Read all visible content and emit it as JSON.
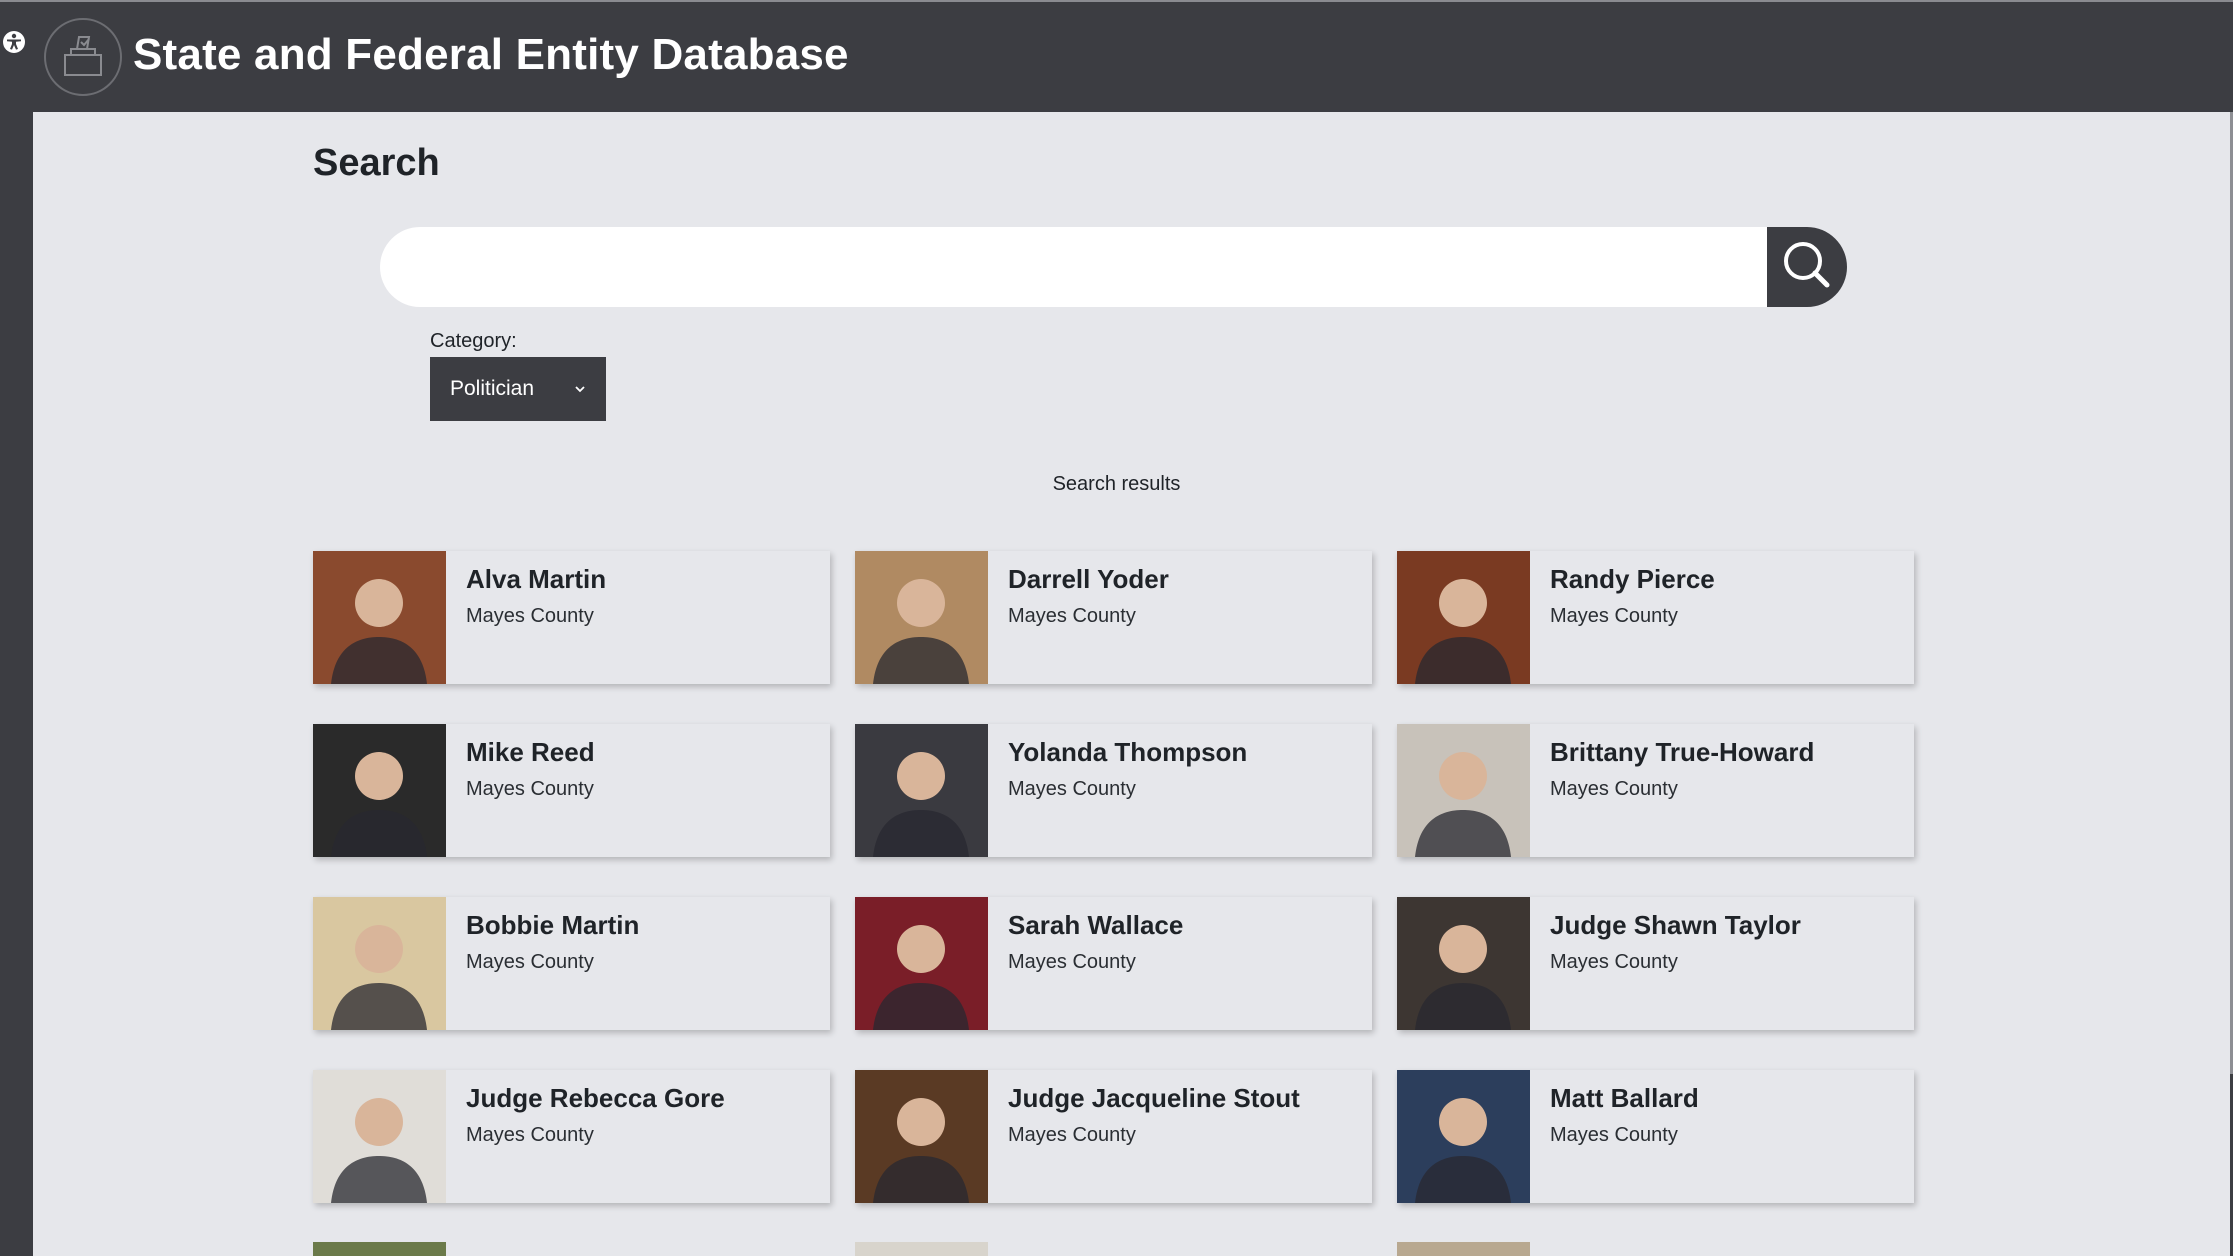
{
  "header": {
    "title": "State and Federal Entity Database",
    "logo_icon": "ballot-box-icon",
    "accessibility_icon": "accessibility-icon"
  },
  "search": {
    "heading": "Search",
    "placeholder": "",
    "value": "",
    "button_icon": "search-icon"
  },
  "category": {
    "label": "Category:",
    "selected": "Politician"
  },
  "results": {
    "heading": "Search results",
    "items": [
      {
        "name": "Alva Martin",
        "county": "Mayes County"
      },
      {
        "name": "Darrell Yoder",
        "county": "Mayes County"
      },
      {
        "name": "Randy Pierce",
        "county": "Mayes County"
      },
      {
        "name": "Mike Reed",
        "county": "Mayes County"
      },
      {
        "name": "Yolanda Thompson",
        "county": "Mayes County"
      },
      {
        "name": "Brittany True-Howard",
        "county": "Mayes County"
      },
      {
        "name": "Bobbie Martin",
        "county": "Mayes County"
      },
      {
        "name": "Sarah Wallace",
        "county": "Mayes County"
      },
      {
        "name": "Judge Shawn Taylor",
        "county": "Mayes County"
      },
      {
        "name": "Judge Rebecca Gore",
        "county": "Mayes County"
      },
      {
        "name": "Judge Jacqueline Stout",
        "county": "Mayes County"
      },
      {
        "name": "Matt Ballard",
        "county": "Mayes County"
      }
    ]
  },
  "colors": {
    "header_bg": "#3c3d42",
    "content_bg": "#e6e7eb",
    "text": "#1f2328",
    "photo_backgrounds": [
      "#8a4a2e",
      "#b08a62",
      "#7a3a22",
      "#2a2a2a",
      "#3a3a40",
      "#c8c2ba",
      "#d9c7a0",
      "#7a1e28",
      "#3d3632",
      "#e0ddd8",
      "#5a3a24",
      "#2c3e5c"
    ]
  }
}
